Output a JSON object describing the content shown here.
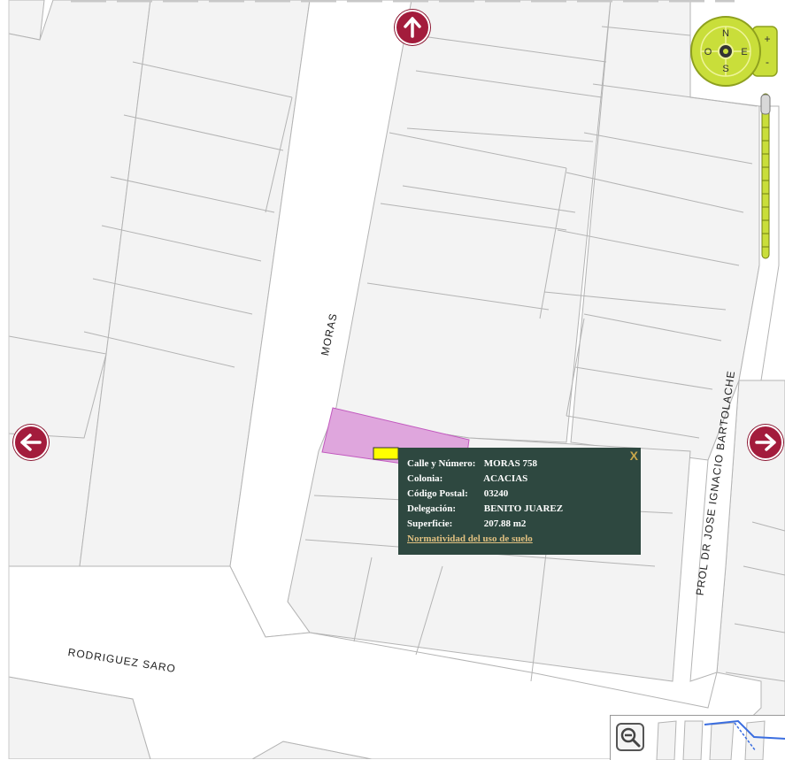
{
  "streets": {
    "moras": "MORAS",
    "rodriguez_saro": "RODRIGUEZ SARO",
    "prol_jose_ignacio": "PROL DR JOSE IGNACIO BARTOLACHE"
  },
  "compass": {
    "north": "N",
    "south": "S",
    "east": "E",
    "west": "O",
    "zoom_in": "+",
    "zoom_out": "-"
  },
  "popup": {
    "close": "X",
    "rows": [
      {
        "label": "Calle y Número:",
        "value": "MORAS 758"
      },
      {
        "label": "Colonia:",
        "value": "ACACIAS"
      },
      {
        "label": "Código Postal:",
        "value": "03240"
      },
      {
        "label": "Delegación:",
        "value": "BENITO JUAREZ"
      },
      {
        "label": "Superficie:",
        "value": "207.88 m2"
      }
    ],
    "link": "Normatividad del uso de suelo"
  },
  "colors": {
    "block": "#f3f3f3",
    "block_stroke": "#b4b4b4",
    "selected_lot": "#dfa6dd",
    "selected_lot_stroke": "#c259bf",
    "nav_arrow": "#a31c3c",
    "popup_bg": "#2e4840",
    "compass": "#c9de3a",
    "marker": "#ffff00"
  },
  "icons": {
    "pan_up": "arrow-up-icon",
    "pan_left": "arrow-left-icon",
    "pan_right": "arrow-right-icon",
    "zoom_out": "magnifier-minus-icon"
  }
}
